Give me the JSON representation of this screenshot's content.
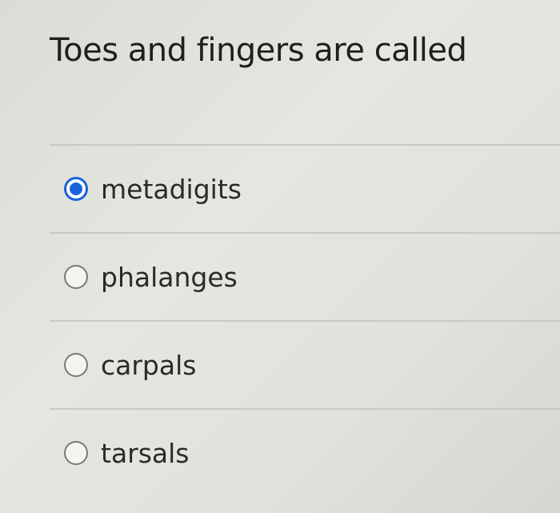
{
  "question": {
    "title": "Toes and fingers are called"
  },
  "answers": [
    {
      "label": "metadigits",
      "selected": true
    },
    {
      "label": "phalanges",
      "selected": false
    },
    {
      "label": "carpals",
      "selected": false
    },
    {
      "label": "tarsals",
      "selected": false
    }
  ],
  "colors": {
    "accent": "#1a63d8",
    "text": "#2a2a2a"
  },
  "icons": {
    "selected": "radio-selected-icon",
    "unselected": "radio-unselected-icon"
  }
}
